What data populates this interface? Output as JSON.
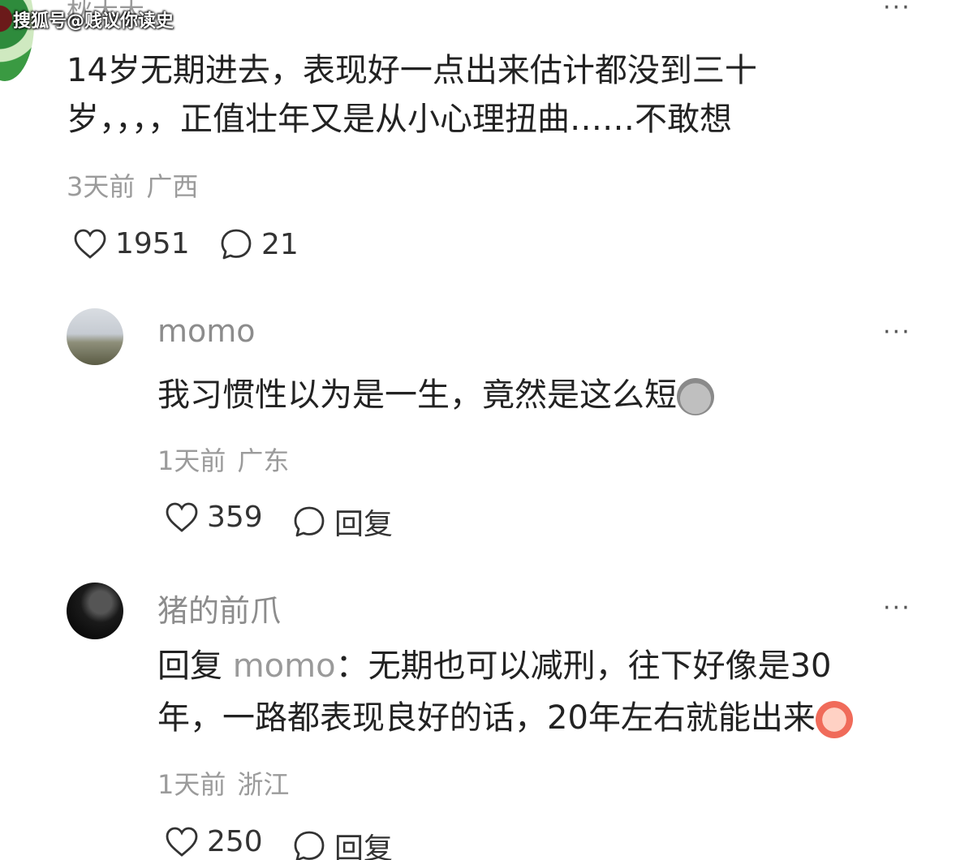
{
  "watermark": "搜狐号@贱议你读史",
  "first_comment": {
    "username_clipped": "秋天天",
    "text_lines": [
      "14岁无期进去，表现好一点出来估计都没到三十",
      "岁，，，，正值壮年又是从小心理扭曲……不敢想"
    ],
    "time": "3天前",
    "location": "广西",
    "likes": "1951",
    "replies": "21"
  },
  "comments": [
    {
      "username": "momo",
      "text": "我习惯性以为是一生，竟然是这么短",
      "emoji": "gray-sad-face-emoji",
      "time": "1天前",
      "location": "广东",
      "likes": "359",
      "reply_label": "回复"
    },
    {
      "username": "猪的前爪",
      "reply_prefix": "回复",
      "reply_to": "momo",
      "text_line1": "：无期也可以减刑，往下好像是30",
      "text_line2": "年，一路都表现良好的话，20年左右就能出来",
      "emoji": "laughing-crying-face-emoji",
      "time": "1天前",
      "location": "浙江",
      "likes": "250",
      "reply_label": "回复"
    }
  ],
  "more_label": "···"
}
